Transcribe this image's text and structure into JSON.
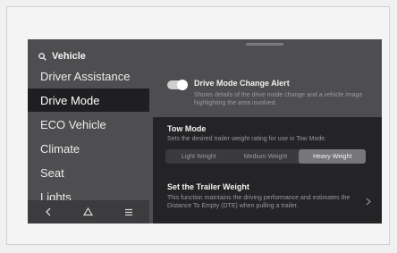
{
  "search": {
    "label": "Vehicle"
  },
  "sidebar": {
    "items": [
      {
        "label": "Driver Assistance"
      },
      {
        "label": "Drive Mode"
      },
      {
        "label": "ECO Vehicle"
      },
      {
        "label": "Climate"
      },
      {
        "label": "Seat"
      },
      {
        "label": "Lights"
      }
    ],
    "active_index": 1
  },
  "bottom_bar": {
    "icons": [
      "back-icon",
      "home-icon",
      "menu-icon"
    ]
  },
  "drive_mode_alert": {
    "title": "Drive Mode Change Alert",
    "description": "Shows details of the drive mode change and a vehicle image highlighting the area involved.",
    "enabled": true
  },
  "tow_mode": {
    "title": "Tow Mode",
    "description": "Sets the desired trailer weight rating for use in Tow Mode.",
    "options": [
      "Light Weight",
      "Medium Weight",
      "Heavy Weight"
    ],
    "selected": "Heavy Weight"
  },
  "trailer_weight": {
    "title": "Set the Trailer Weight",
    "description": "This function maintains the driving performance and estimates the Distance To Empty (DTE) when pulling a trailer."
  },
  "colors": {
    "screen_bg": "#4e4e50",
    "panel_bg": "#242426",
    "active_item_bg": "#1f1f21",
    "selected_segment": "#77777a"
  }
}
